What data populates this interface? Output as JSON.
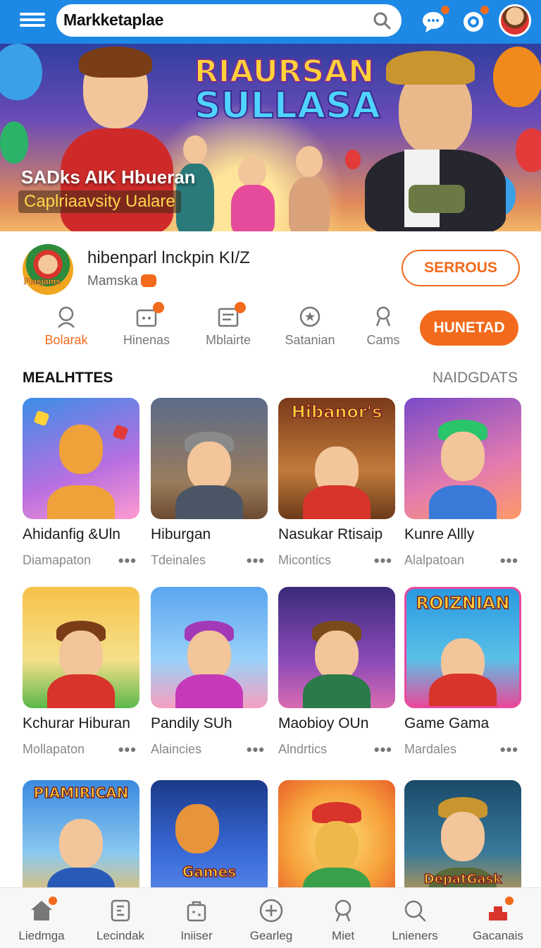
{
  "header": {
    "brand": "Markketaplae",
    "search_icon": "search-icon",
    "menu_icon": "hamburger-icon",
    "chat_icon": "chat-bubble-icon",
    "notification_icon": "notification-icon"
  },
  "banner": {
    "logo_line1": "RIAURSAN",
    "logo_line2": "SULLASA",
    "title": "SADks AIK Hbueran",
    "subtitle": "Caplriaavsity Ualare"
  },
  "app": {
    "logo_text": "Plasjams",
    "title": "hibenparl lnckpin KI/Z",
    "developer": "Mamska",
    "outline_button": "SERROUS",
    "solid_button": "HUNETAD"
  },
  "tabs": [
    {
      "label": "Bolarak",
      "icon": "user-icon",
      "active": true,
      "badge": false
    },
    {
      "label": "Hinenas",
      "icon": "gamepad-icon",
      "active": false,
      "badge": true
    },
    {
      "label": "Mblairte",
      "icon": "document-icon",
      "active": false,
      "badge": true
    },
    {
      "label": "Satanian",
      "icon": "star-icon",
      "active": false,
      "badge": false
    },
    {
      "label": "Cams",
      "icon": "person-icon",
      "active": false,
      "badge": false
    }
  ],
  "section": {
    "title": "MEALHTTES",
    "more": "NAIDGDATS"
  },
  "cards": [
    {
      "name": "Ahidanfig &Uln",
      "meta": "Diamapaton"
    },
    {
      "name": "Hiburgan",
      "meta": "Tdeinales"
    },
    {
      "name": "Nasukar Rtisaip",
      "meta": "Micontics"
    },
    {
      "name": "Kunre Allly",
      "meta": "Alalpatoan"
    },
    {
      "name": "Kchurar Hiburan",
      "meta": "Mollapaton"
    },
    {
      "name": "Pandily SUh",
      "meta": "Alaincies"
    },
    {
      "name": "Maobioy OUn",
      "meta": "Alndrtics"
    },
    {
      "name": "Game Gama",
      "meta": "Mardales"
    },
    {
      "name": "",
      "meta": ""
    },
    {
      "name": "",
      "meta": ""
    },
    {
      "name": "",
      "meta": ""
    },
    {
      "name": "",
      "meta": ""
    }
  ],
  "card_titles": {
    "c3": "Hibanor's",
    "c8": "ROIZNIAN",
    "c9": "PIAMIRICAN",
    "c10": "Games",
    "c12": "DepatGask"
  },
  "bottom_nav": [
    {
      "label": "Liedmga",
      "icon": "home-icon",
      "badge": true
    },
    {
      "label": "Lecindak",
      "icon": "bookmark-icon",
      "badge": false
    },
    {
      "label": "Iniiser",
      "icon": "bag-icon",
      "badge": false
    },
    {
      "label": "Gearleg",
      "icon": "plus-circle-icon",
      "badge": false
    },
    {
      "label": "Miet",
      "icon": "profile-icon",
      "badge": false
    },
    {
      "label": "Lnieners",
      "icon": "search-icon",
      "badge": false
    },
    {
      "label": "Gacanais",
      "icon": "gift-icon",
      "badge": true
    }
  ],
  "colors": {
    "primary": "#1e88e5",
    "accent": "#f26a1b"
  }
}
